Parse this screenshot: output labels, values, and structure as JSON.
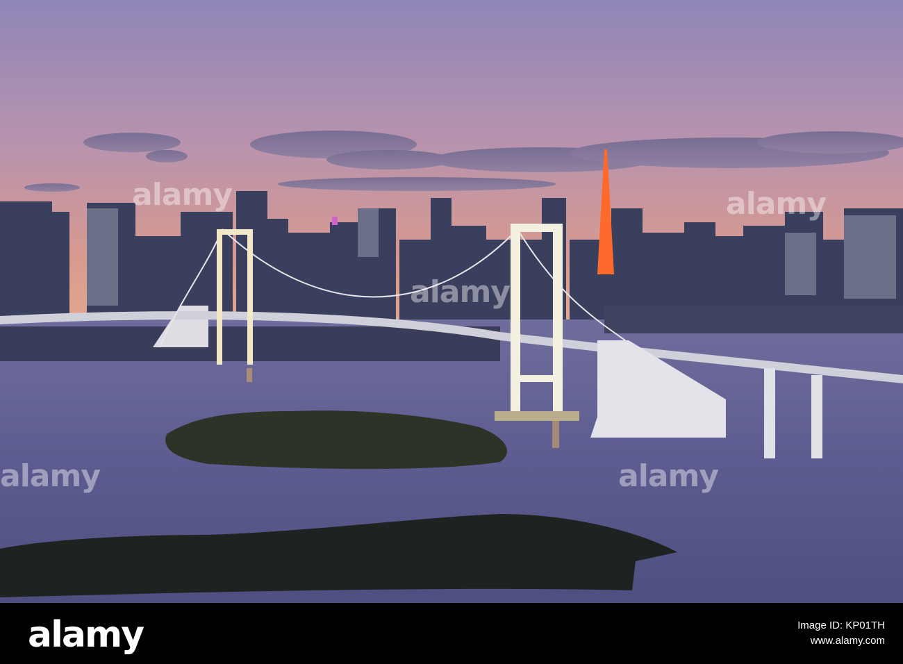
{
  "photo": {
    "subject": "Rainbow Bridge and Tokyo Tower skyline at dusk over Tokyo Bay",
    "colors": {
      "sky_top": "#8f86b8",
      "sky_mid": "#c49aa8",
      "horizon": "#e29d86",
      "water": "#5f5f92",
      "bridge": "#e8e6e4",
      "tower": "#ff6a2a"
    }
  },
  "watermark": {
    "text": "alamy"
  },
  "footer": {
    "logo": "alamy",
    "image_id_label": "Image ID: KP01TH",
    "url": "www.alamy.com"
  }
}
